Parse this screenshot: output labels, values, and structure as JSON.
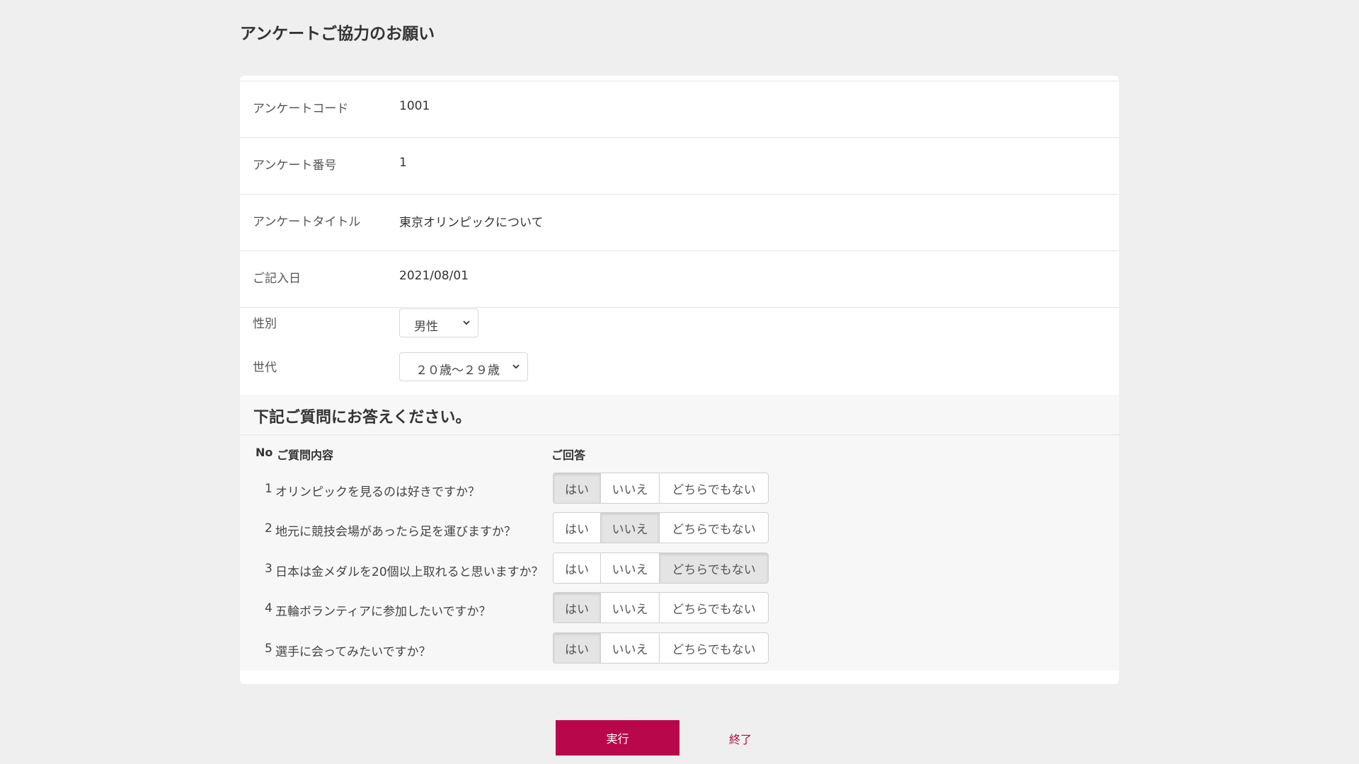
{
  "page": {
    "title": "アンケートご協力のお願い"
  },
  "info": [
    {
      "label": "アンケートコード",
      "value": "1001"
    },
    {
      "label": "アンケート番号",
      "value": "1"
    },
    {
      "label": "アンケートタイトル",
      "value": "東京オリンピックについて"
    },
    {
      "label": "ご記入日",
      "value": "2021/08/01"
    }
  ],
  "form": {
    "gender": {
      "label": "性別",
      "value": "男性"
    },
    "generation": {
      "label": "世代",
      "value": "２０歳～２９歳"
    }
  },
  "questions_section": {
    "heading": "下記ご質問にお答えください。",
    "col_no": "No",
    "col_question": "ご質問内容",
    "col_answer": "ご回答",
    "options": [
      "はい",
      "いいえ",
      "どちらでもない"
    ],
    "items": [
      {
        "no": "1",
        "text": "オリンピックを見るのは好きですか？",
        "selected": "はい"
      },
      {
        "no": "2",
        "text": "地元に競技会場があったら足を運びますか？",
        "selected": "いいえ"
      },
      {
        "no": "3",
        "text": "日本は金メダルを20個以上取れると思いますか？",
        "selected": "どちらでもない"
      },
      {
        "no": "4",
        "text": "五輪ボランティアに参加したいですか？",
        "selected": "はい"
      },
      {
        "no": "5",
        "text": "選手に会ってみたいですか？",
        "selected": "はい"
      }
    ]
  },
  "actions": {
    "execute": "実行",
    "end": "終了"
  },
  "colors": {
    "accent": "#b8074a",
    "background": "#efefef",
    "selected_option": "#e4e4e4"
  }
}
